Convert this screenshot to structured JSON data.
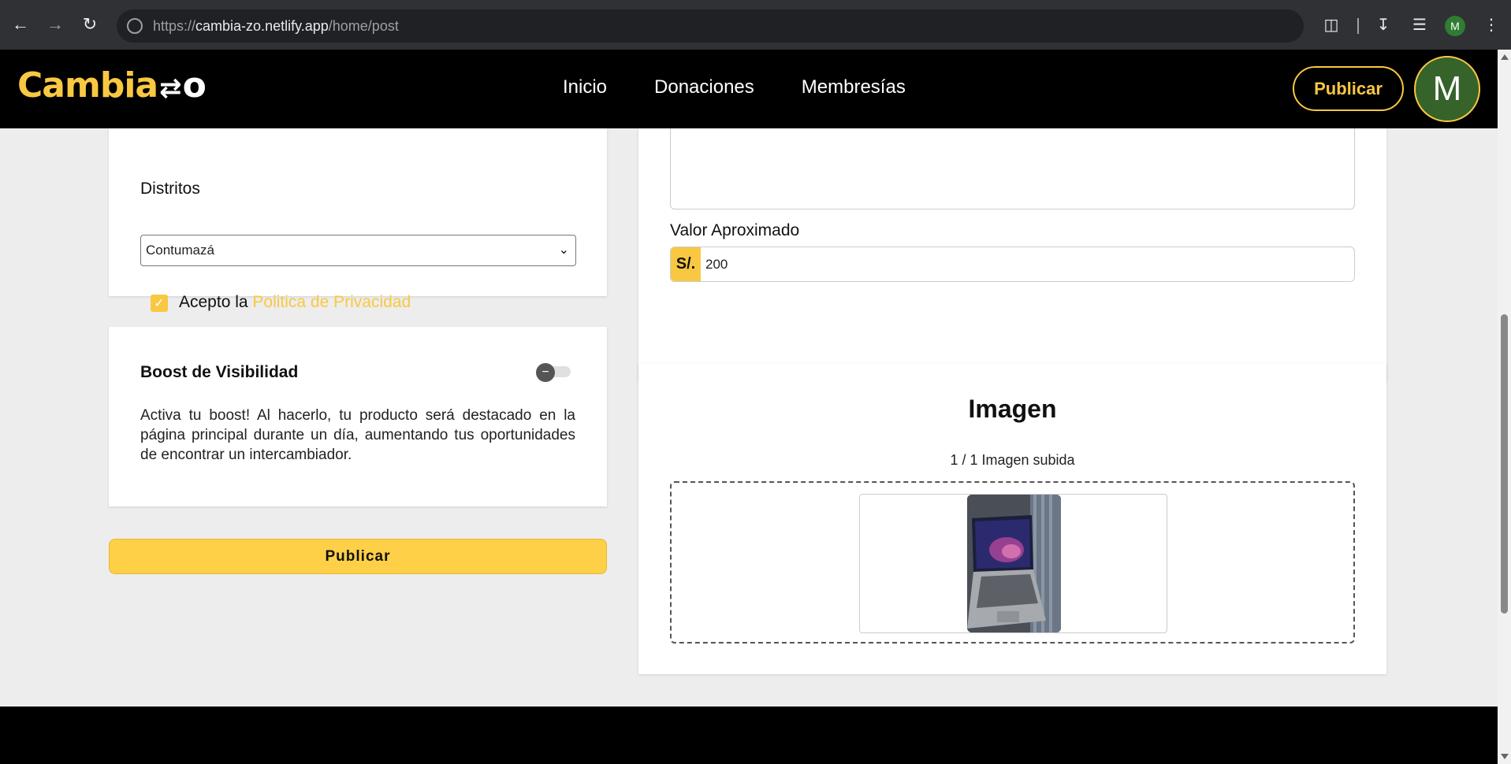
{
  "browser": {
    "url_scheme": "https://",
    "url_host": "cambia-zo.netlify.app",
    "url_path": "/home/post",
    "profile_initial": "M"
  },
  "header": {
    "logo_text_a": "Cambia",
    "logo_text_b": "o",
    "nav": [
      "Inicio",
      "Donaciones",
      "Membresías"
    ],
    "publish_label": "Publicar",
    "avatar_initial": "M"
  },
  "form": {
    "distritos_label": "Distritos",
    "distritos_value": "Contumazá",
    "accept_prefix": "Acepto la",
    "accept_link": "Politica de Privacidad",
    "accept_checked": true,
    "valor_label": "Valor Aproximado",
    "valor_prefix": "S/.",
    "valor_value": "200"
  },
  "boost": {
    "title": "Boost de Visibilidad",
    "enabled": false,
    "description": "Activa tu boost! Al hacerlo, tu producto será destacado en la página principal durante un día, aumentando tus oportunidades de encontrar un intercambiador."
  },
  "imagen": {
    "title": "Imagen",
    "count_text": "1 / 1 Imagen subida"
  },
  "submit_label": "Publicar",
  "colors": {
    "accent": "#f9c842",
    "header_bg": "#000000",
    "avatar_bg": "#35632a"
  }
}
